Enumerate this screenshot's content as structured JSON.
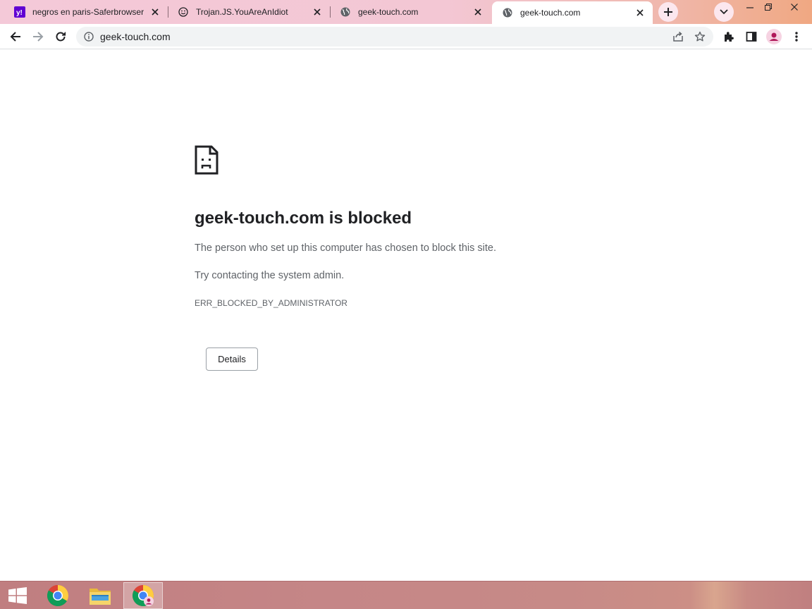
{
  "tabs": [
    {
      "title": "negros en paris-Saferbrowser",
      "favicon": "yahoo-icon",
      "active": false
    },
    {
      "title": "Trojan.JS.YouAreAnIdiot",
      "favicon": "smiley-icon",
      "active": false
    },
    {
      "title": "geek-touch.com",
      "favicon": "globe-icon",
      "active": false
    },
    {
      "title": "geek-touch.com",
      "favicon": "globe-icon",
      "active": true
    }
  ],
  "omnibox": {
    "url": "geek-touch.com"
  },
  "error_page": {
    "title": "geek-touch.com is blocked",
    "message": "The person who set up this computer has chosen to block this site.",
    "suggestion": "Try contacting the system admin.",
    "error_code": "ERR_BLOCKED_BY_ADMINISTRATOR",
    "details_label": "Details"
  },
  "taskbar": {
    "items": [
      "start-button",
      "chrome-icon",
      "file-explorer-icon",
      "chrome-profile-icon"
    ]
  },
  "colors": {
    "accent": "#f4c9d8",
    "text": "#202124",
    "muted": "#5f6368",
    "yahoo": "#6001d2"
  }
}
